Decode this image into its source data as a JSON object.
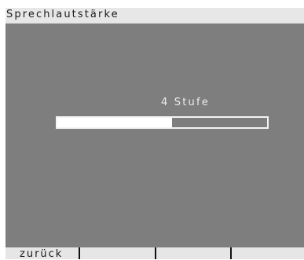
{
  "screen": {
    "title": "Sprechlautstärke"
  },
  "volume": {
    "level_label": "4 Stufe",
    "level_fraction": 0.545
  },
  "softkeys": [
    {
      "label": "zurück"
    },
    {
      "label": ""
    },
    {
      "label": ""
    },
    {
      "label": ""
    }
  ],
  "colors": {
    "content_background": "#7e7e7e",
    "title_background": "#e7e7e7",
    "softkey_background": "#e6e6e6",
    "bar_fill": "#ffffff"
  }
}
